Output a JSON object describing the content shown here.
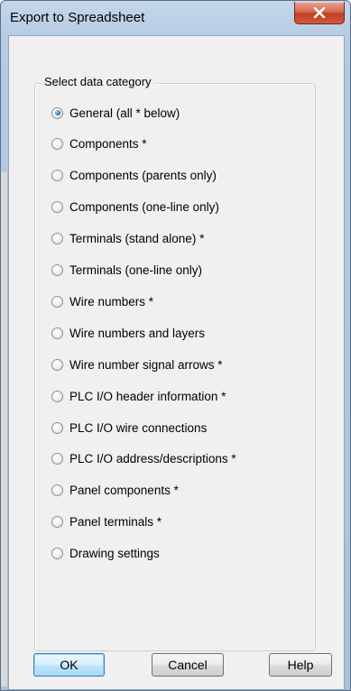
{
  "window": {
    "title": "Export to Spreadsheet"
  },
  "group": {
    "label": "Select data category",
    "selected_index": 0,
    "options": [
      "General (all * below)",
      "Components *",
      "Components (parents only)",
      "Components (one-line only)",
      "Terminals (stand alone) *",
      "Terminals (one-line only)",
      "Wire numbers *",
      "Wire numbers and layers",
      "Wire number signal arrows *",
      "PLC I/O header information *",
      "PLC I/O wire connections",
      "PLC I/O address/descriptions *",
      "Panel components *",
      "Panel terminals *",
      "Drawing settings"
    ]
  },
  "buttons": {
    "ok": "OK",
    "cancel": "Cancel",
    "help": "Help"
  }
}
